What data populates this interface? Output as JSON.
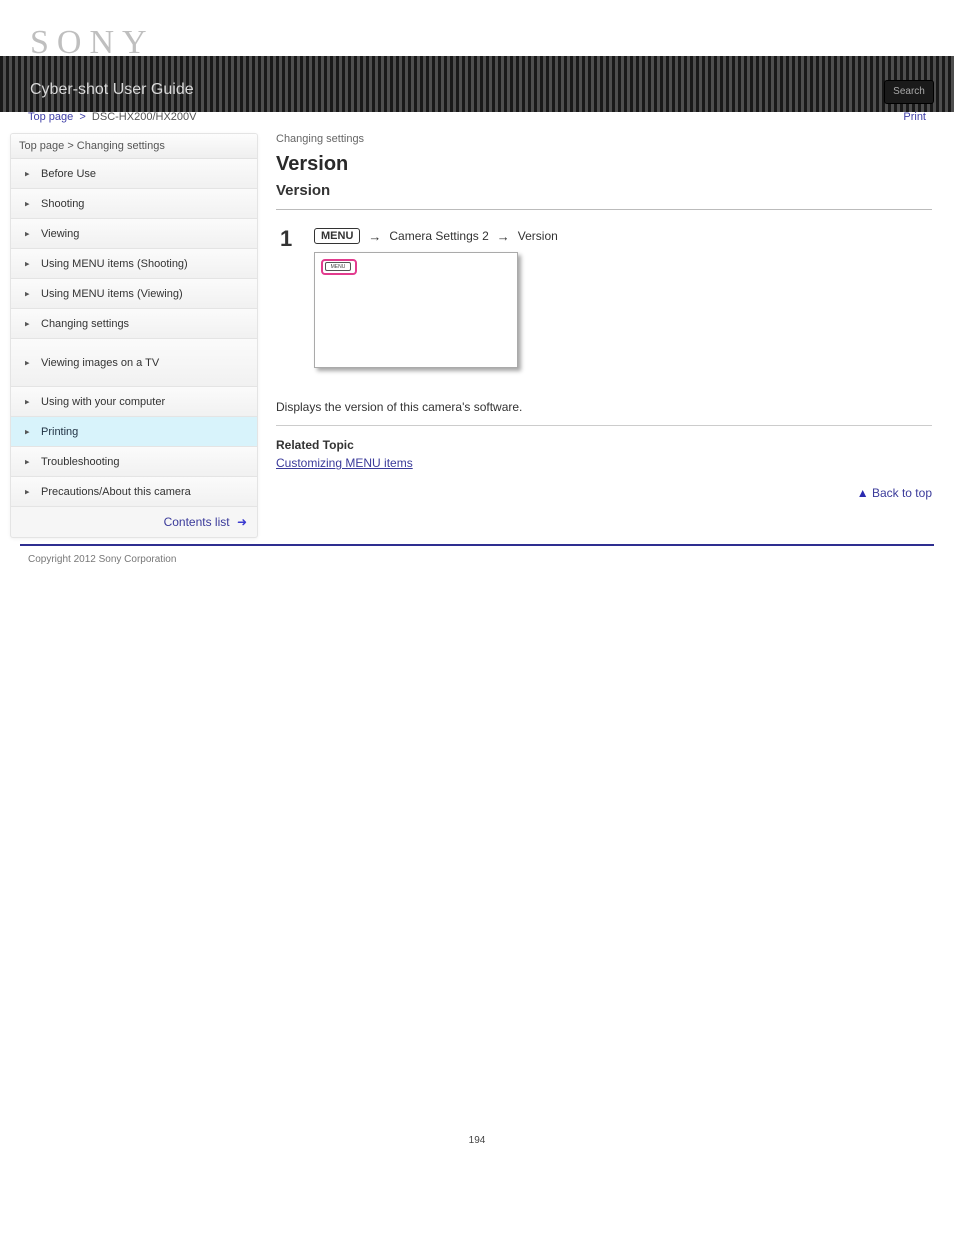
{
  "header": {
    "brand": "SONY",
    "guide_title": "Cyber-shot User Guide",
    "search_label": "Search",
    "model": "DSC-HX200/HX200V",
    "top_link": "Top page",
    "print_label": "Print"
  },
  "sidebar": {
    "head": "Top page > Changing settings",
    "items": [
      {
        "label": "Before Use"
      },
      {
        "label": "Shooting"
      },
      {
        "label": "Viewing"
      },
      {
        "label": "Using MENU items (Shooting)"
      },
      {
        "label": "Using MENU items (Viewing)"
      },
      {
        "label": "Changing settings"
      },
      {
        "label": "Viewing images on a TV",
        "tall": true
      },
      {
        "label": "Using with your computer"
      },
      {
        "label": "Printing",
        "active": true
      },
      {
        "label": "Troubleshooting"
      },
      {
        "label": "Precautions/About this camera"
      }
    ],
    "contents_label": "Contents list"
  },
  "content": {
    "section": "Changing settings",
    "title": "Version",
    "step_num": "1",
    "crumb1": "Camera Settings 2",
    "crumb2": "Version",
    "menu_badge": "MENU",
    "screen_inner_label": "MENU",
    "description": "Displays the version of this camera's software.",
    "related_title": "Related Topic",
    "related_link": "Customizing MENU items",
    "back_top": "Back to top"
  },
  "footer": {
    "copyright": "Copyright 2012 Sony Corporation",
    "page_num": "194"
  }
}
